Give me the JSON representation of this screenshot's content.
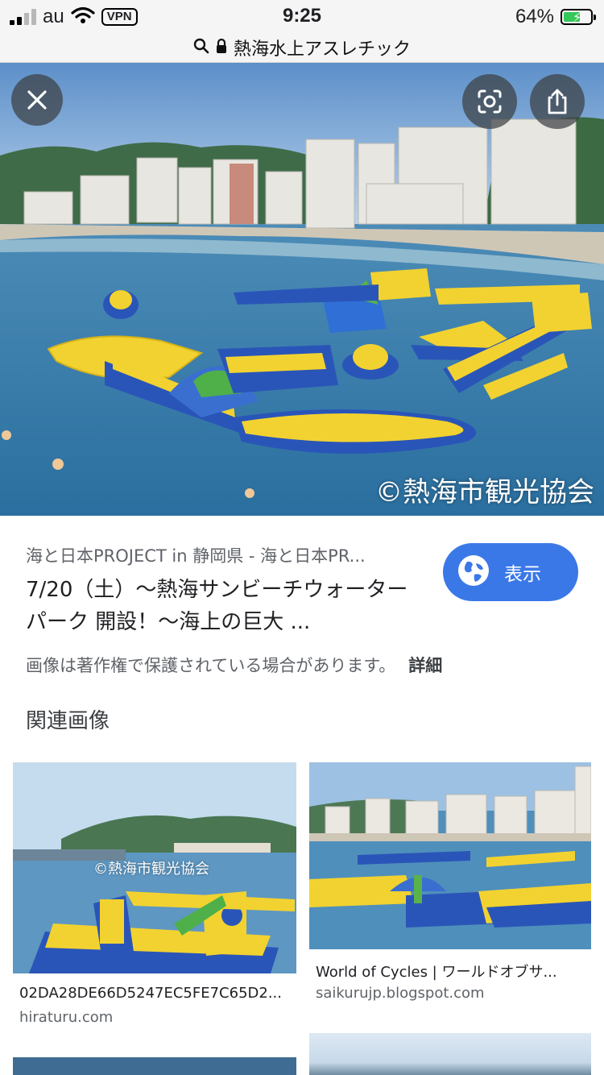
{
  "status": {
    "carrier": "au",
    "vpn": "VPN",
    "time": "9:25",
    "battery_pct": "64%",
    "battery_level": 0.64
  },
  "urlbar": {
    "url_text": "熱海水上アスレチック"
  },
  "hero": {
    "watermark": "©熱海市観光協会"
  },
  "result": {
    "source": "海と日本PROJECT in 静岡県 - 海と日本PR...",
    "title": "7/20（土）〜熱海サンビーチウォーターパーク 開設！〜海上の巨大 ...",
    "view_button": "表示",
    "copyright": "画像は著作権で保護されている場合があります。",
    "detail_link": "詳細"
  },
  "related": {
    "heading": "関連画像",
    "items": [
      {
        "caption": "02DA28DE66D5247EC5FE7C65D2...",
        "domain": "hiraturu.com",
        "watermark": "©熱海市観光協会"
      },
      {
        "caption": "World of Cycles | ワールドオブサ...",
        "domain": "saikurujp.blogspot.com"
      }
    ]
  },
  "colors": {
    "accent_blue": "#3b78e7",
    "inflatable_yellow": "#f2d230",
    "inflatable_blue": "#2a55b8",
    "sea": "#2f7fb3"
  },
  "icons": [
    "signal-icon",
    "wifi-icon",
    "search-icon",
    "lock-icon",
    "close-icon",
    "lens-icon",
    "share-icon",
    "globe-icon"
  ]
}
